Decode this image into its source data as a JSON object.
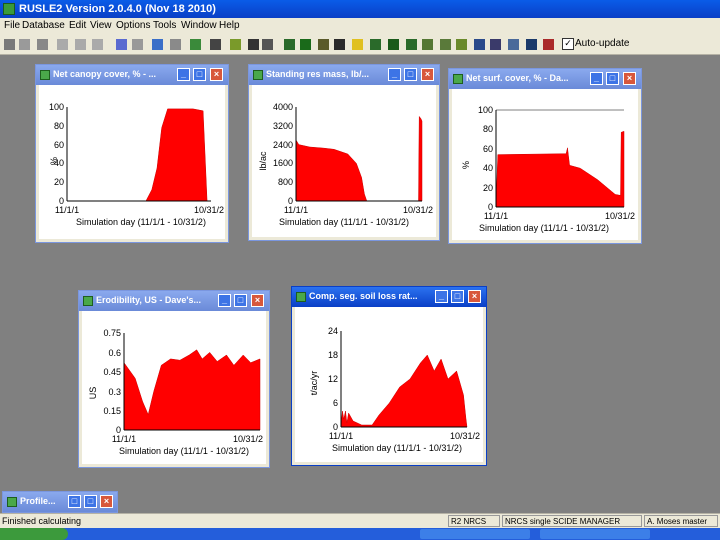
{
  "app": {
    "title": "RUSLE2 Version 2.0.4.0 (Nov 18 2010)"
  },
  "menu": [
    "File",
    "Database",
    "Edit",
    "View",
    "Options",
    "Tools",
    "Window",
    "Help"
  ],
  "toolbar": {
    "auto_update_label": "Auto-update",
    "auto_update_checked": true
  },
  "windows": {
    "canopy": {
      "title": "Net canopy cover, % - ...",
      "ylabel": "%",
      "yticks": [
        "100",
        "80",
        "60",
        "40",
        "20",
        "0"
      ],
      "xtick_left": "11/1/1",
      "xtick_right": "10/31/2",
      "xlabel": "Simulation day (11/1/1 - 10/31/2)"
    },
    "residue": {
      "title": "Standing res mass, lb/...",
      "ylabel": "lb/ac",
      "yticks": [
        "4000",
        "3200",
        "2400",
        "1600",
        "800",
        "0"
      ],
      "xtick_left": "11/1/1",
      "xtick_right": "10/31/2",
      "xlabel": "Simulation day (11/1/1 - 10/31/2)"
    },
    "surface": {
      "title": "Net surf. cover, % - Da...",
      "ylabel": "%",
      "yticks": [
        "100",
        "80",
        "60",
        "40",
        "20",
        "0"
      ],
      "xtick_left": "11/1/1",
      "xtick_right": "10/31/2",
      "xlabel": "Simulation day (11/1/1 - 10/31/2)"
    },
    "erodibility": {
      "title": "Erodibility, US - Dave's...",
      "ylabel": "US",
      "yticks": [
        "0.75",
        "0.6",
        "0.45",
        "0.3",
        "0.15",
        "0"
      ],
      "xtick_left": "11/1/1",
      "xtick_right": "10/31/2",
      "xlabel": "Simulation day (11/1/1 - 10/31/2)"
    },
    "soilloss": {
      "title": "Comp. seg. soil loss rat...",
      "ylabel": "t/ac/yr",
      "yticks": [
        "24",
        "18",
        "12",
        "6",
        "0"
      ],
      "xtick_left": "11/1/1",
      "xtick_right": "10/31/2",
      "xlabel": "Simulation day (11/1/1 - 10/31/2)"
    },
    "profile": {
      "title": "Profile..."
    }
  },
  "chart_data": [
    {
      "type": "area",
      "id": "canopy",
      "title": "Net canopy cover, % - ...",
      "ylabel": "%",
      "xlabel": "Simulation day (11/1/1 - 10/31/2)",
      "ylim": [
        0,
        100
      ],
      "xlim": [
        0,
        365
      ],
      "x": [
        0,
        200,
        215,
        228,
        240,
        255,
        290,
        320,
        345,
        355,
        365
      ],
      "values": [
        0,
        0,
        12,
        35,
        78,
        98,
        98,
        98,
        96,
        0,
        0
      ],
      "color": "#ff0000"
    },
    {
      "type": "area",
      "id": "residue",
      "title": "Standing res mass, lb/...",
      "ylabel": "lb/ac",
      "xlabel": "Simulation day (11/1/1 - 10/31/2)",
      "ylim": [
        0,
        4000
      ],
      "xlim": [
        0,
        365
      ],
      "x": [
        0,
        8,
        40,
        80,
        110,
        150,
        175,
        190,
        198,
        205,
        355,
        357,
        362,
        365
      ],
      "values": [
        2600,
        2400,
        2300,
        2250,
        2200,
        2000,
        1600,
        1000,
        300,
        0,
        0,
        3600,
        3500,
        3400
      ],
      "color": "#ff0000"
    },
    {
      "type": "area",
      "id": "surface",
      "title": "Net surf. cover, % - Da...",
      "ylabel": "%",
      "xlabel": "Simulation day (11/1/1 - 10/31/2)",
      "ylim": [
        0,
        100
      ],
      "xlim": [
        0,
        365
      ],
      "x": [
        0,
        5,
        200,
        204,
        210,
        240,
        290,
        330,
        340,
        355,
        357,
        365
      ],
      "values": [
        0,
        54,
        55,
        61,
        43,
        40,
        28,
        16,
        13,
        12,
        77,
        78
      ],
      "color": "#ff0000"
    },
    {
      "type": "area",
      "id": "erodibility",
      "title": "Erodibility, US - Dave's...",
      "ylabel": "US",
      "xlabel": "Simulation day (11/1/1 - 10/31/2)",
      "ylim": [
        0,
        0.75
      ],
      "xlim": [
        0,
        365
      ],
      "x": [
        0,
        5,
        30,
        50,
        65,
        80,
        100,
        125,
        150,
        175,
        195,
        210,
        230,
        250,
        275,
        295,
        320,
        340,
        365
      ],
      "values": [
        0.52,
        0.5,
        0.4,
        0.22,
        0.12,
        0.3,
        0.5,
        0.55,
        0.54,
        0.58,
        0.62,
        0.55,
        0.6,
        0.53,
        0.58,
        0.5,
        0.58,
        0.52,
        0.55
      ],
      "color": "#ff0000"
    },
    {
      "type": "area",
      "id": "soilloss",
      "title": "Comp. seg. soil loss rat...",
      "ylabel": "t/ac/yr",
      "xlabel": "Simulation day (11/1/1 - 10/31/2)",
      "ylim": [
        0,
        24
      ],
      "xlim": [
        0,
        365
      ],
      "x": [
        0,
        4,
        8,
        13,
        17,
        22,
        35,
        60,
        90,
        110,
        140,
        170,
        200,
        230,
        250,
        270,
        290,
        310,
        335,
        355,
        362,
        365
      ],
      "values": [
        0,
        4,
        2,
        4,
        1,
        3.5,
        1.5,
        0.5,
        0.5,
        3,
        6,
        10,
        12,
        16,
        18,
        14,
        17,
        12,
        14,
        8,
        2,
        0
      ],
      "color": "#ff0000"
    }
  ],
  "statusbar": {
    "text": "Finished calculating",
    "cell1": "R2 NRCS",
    "cell2": "NRCS single SCIDE MANAGER",
    "cell3": "A. Moses master"
  }
}
